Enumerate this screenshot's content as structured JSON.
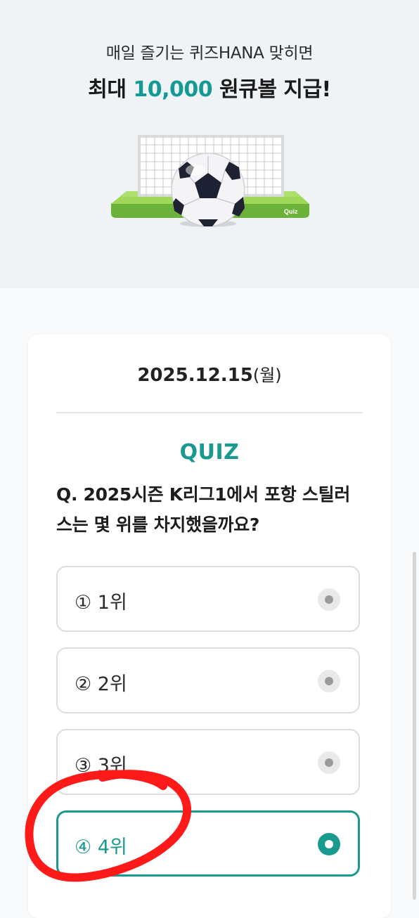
{
  "hero": {
    "subtitle": "매일 즐기는 퀴즈HANA 맞히면",
    "headline_prefix": "최대 ",
    "headline_amount": "10,000",
    "headline_suffix": " 원큐볼 지급!",
    "badge": "Quiz"
  },
  "quiz": {
    "date": "2025.12.15",
    "weekday": "(월)",
    "label": "QUIZ",
    "question": "Q. 2025시즌 K리그1에서 포항 스틸러스는 몇 위를 차지했을까요?",
    "options": [
      {
        "label": "① 1위",
        "selected": false
      },
      {
        "label": "② 2위",
        "selected": false
      },
      {
        "label": "③ 3위",
        "selected": false
      },
      {
        "label": "④ 4위",
        "selected": true
      }
    ]
  },
  "colors": {
    "accent": "#1a9a8f",
    "annotation": "#ff1a1a",
    "field_green": "#7dc241"
  }
}
